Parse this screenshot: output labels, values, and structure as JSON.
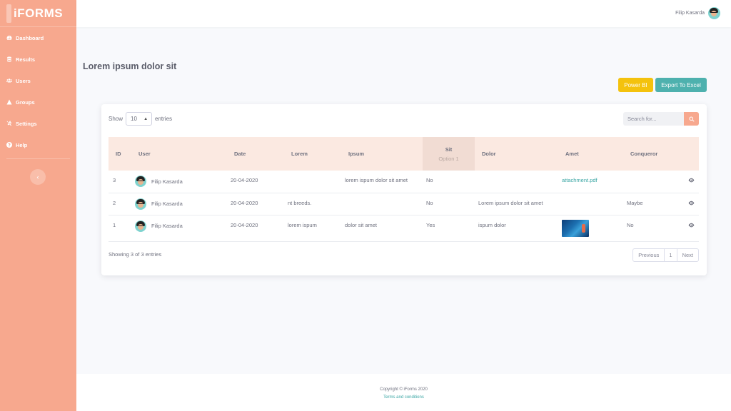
{
  "brand": {
    "name": "iFORMS"
  },
  "sidebar": {
    "items": [
      {
        "label": "Dashboard",
        "icon": "dashboard-icon"
      },
      {
        "label": "Results",
        "icon": "database-icon"
      },
      {
        "label": "Users",
        "icon": "users-icon"
      },
      {
        "label": "Groups",
        "icon": "groups-icon"
      },
      {
        "label": "Settings",
        "icon": "tools-icon"
      },
      {
        "label": "Help",
        "icon": "help-icon"
      }
    ],
    "toggle_label": "‹"
  },
  "topbar": {
    "user_name": "Filip Kasarda"
  },
  "page": {
    "title": "Lorem ipsum dolor sit"
  },
  "actions": {
    "powerbi": "Power BI",
    "excel": "Export To Excel"
  },
  "table_controls": {
    "show_label": "Show",
    "entries_value": "10",
    "entries_label": "entries",
    "search_placeholder": "Search for..."
  },
  "table": {
    "columns": [
      "ID",
      "User",
      "Date",
      "Lorem",
      "Ipsum",
      "Sit",
      "Dolor",
      "Amet",
      "Conqueror"
    ],
    "sit_option": "Option 1",
    "rows": [
      {
        "id": "3",
        "user": "Filip Kasarda",
        "date": "20-04-2020",
        "lorem": "",
        "ipsum": "lorem ispum dolor sit amet",
        "sit": "No",
        "dolor": "",
        "amet": "attachment.pdf",
        "conqueror": ""
      },
      {
        "id": "2",
        "user": "Filip Kasarda",
        "date": "20-04-2020",
        "lorem": "nt breeds.",
        "ipsum": "",
        "sit": "No",
        "dolor": "Lorem ipsum dolor sit amet",
        "amet": "",
        "conqueror": "Maybe"
      },
      {
        "id": "1",
        "user": "Filip Kasarda",
        "date": "20-04-2020",
        "lorem": "lorem ispum",
        "ipsum": "dolor sit amet",
        "sit": "Yes",
        "dolor": "ispum dolor",
        "amet": "",
        "conqueror": "No"
      }
    ]
  },
  "table_footer": {
    "info": "Showing 3 of 3 entries",
    "previous": "Previous",
    "page": "1",
    "next": "Next"
  },
  "footer": {
    "copyright": "Copyright © iForms 2020",
    "terms": "Terms and conditions"
  },
  "colors": {
    "sidebar": "#f7a88e",
    "header_row": "#fbe9e1",
    "powerbi": "#f4c20d",
    "excel": "#4eb1ae",
    "link": "#3aa6a4"
  }
}
